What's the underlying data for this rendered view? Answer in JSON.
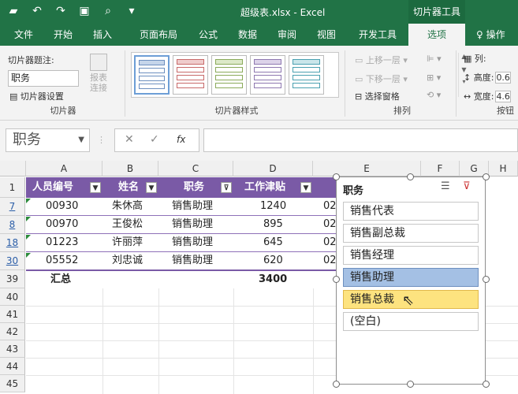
{
  "titlebar": {
    "title": "超级表.xlsx  -  Excel",
    "tools_context": "切片器工具"
  },
  "tabs": [
    "文件",
    "开始",
    "插入",
    "页面布局",
    "公式",
    "数据",
    "审阅",
    "视图",
    "开发工具",
    "选项",
    "操作"
  ],
  "ribbon": {
    "caption_label": "切片器题注:",
    "caption_value": "职务",
    "slicer_settings": "切片器设置",
    "report_connections": "报表\n连接",
    "group_slicer": "切片器",
    "group_styles": "切片器样式",
    "bring_forward": "上移一层",
    "send_backward": "下移一层",
    "selection_pane": "选择窗格",
    "group_arrange": "排列",
    "columns_label": "列:",
    "height_label": "高度:",
    "height_value": "0.6",
    "width_label": "宽度:",
    "width_value": "4.6",
    "group_buttons": "按钮"
  },
  "formula_bar": {
    "name_box": "职务",
    "fx": "fx"
  },
  "columns": [
    "A",
    "B",
    "C",
    "D",
    "E",
    "F",
    "G",
    "H"
  ],
  "table": {
    "headers": [
      "人员编号",
      "姓名",
      "职务",
      "工作津贴"
    ],
    "rows": [
      {
        "row": "7",
        "id": "00930",
        "name": "朱休高",
        "title": "销售助理",
        "allowance": "1240",
        "e": "02"
      },
      {
        "row": "8",
        "id": "00970",
        "name": "王俊松",
        "title": "销售助理",
        "allowance": "895",
        "e": "02"
      },
      {
        "row": "18",
        "id": "01223",
        "name": "许丽萍",
        "title": "销售助理",
        "allowance": "645",
        "e": "02"
      },
      {
        "row": "30",
        "id": "05552",
        "name": "刘忠诚",
        "title": "销售助理",
        "allowance": "620",
        "e": "02"
      }
    ],
    "total_row": "39",
    "total_label": "汇总",
    "total_value": "3400",
    "header_row": "1",
    "empty_rows": [
      "40",
      "41",
      "42",
      "43",
      "44",
      "45"
    ]
  },
  "slicer": {
    "title": "职务",
    "items": [
      "销售代表",
      "销售副总裁",
      "销售经理",
      "销售助理",
      "销售总裁",
      "(空白)"
    ],
    "selected": "销售助理",
    "hovered": "销售总裁"
  },
  "colors": {
    "excel_green": "#217346",
    "table_header": "#7a5aa6",
    "slicer_selected": "#a4c0e4",
    "slicer_hover": "#fde37f"
  }
}
